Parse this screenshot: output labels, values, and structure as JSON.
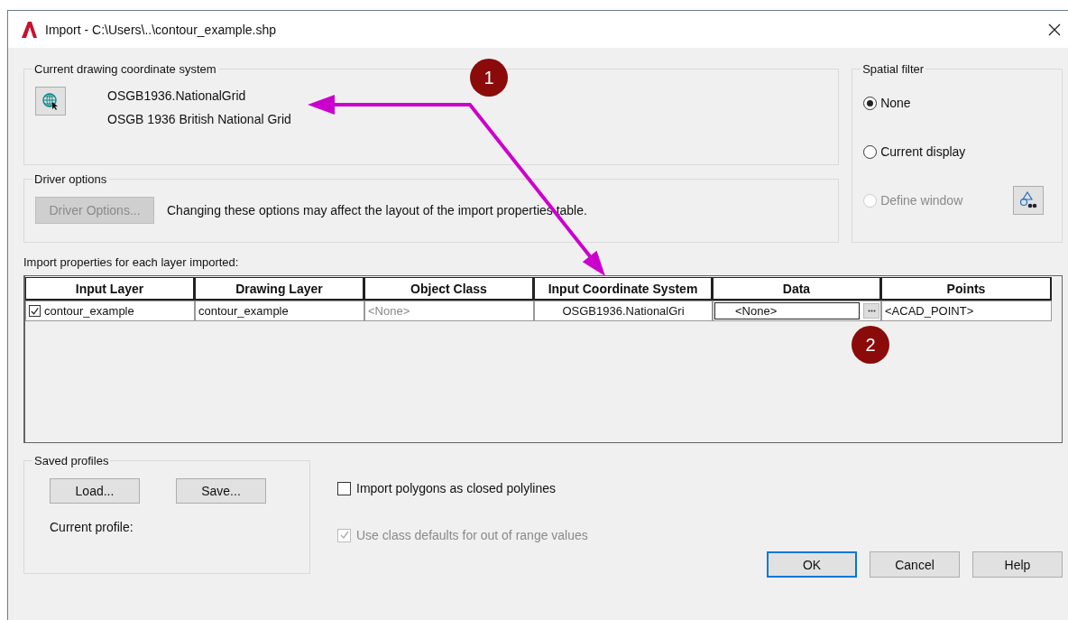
{
  "window": {
    "title": "Import - C:\\Users\\..\\contour_example.shp"
  },
  "coordinate_system": {
    "title": "Current drawing coordinate system",
    "code": "OSGB1936.NationalGrid",
    "description": "OSGB 1936 British National Grid"
  },
  "driver_options": {
    "title": "Driver options",
    "button": {
      "label": "Driver Options...",
      "disabled": true
    },
    "note": "Changing these options may affect the layout of the import properties table."
  },
  "spatial_filter": {
    "title": "Spatial filter",
    "options": [
      {
        "label": "None",
        "selected": true,
        "disabled": false
      },
      {
        "label": "Current display",
        "selected": false,
        "disabled": false
      },
      {
        "label": "Define window",
        "selected": false,
        "disabled": true
      }
    ]
  },
  "table": {
    "caption": "Import properties for each layer imported:",
    "columns": [
      "Input Layer",
      "Drawing Layer",
      "Object Class",
      "Input Coordinate System",
      "Data",
      "Points"
    ],
    "rows": [
      {
        "checked": true,
        "cells": [
          {
            "kind": "text",
            "text": "contour_example"
          },
          {
            "kind": "text",
            "text": "contour_example"
          },
          {
            "kind": "muted",
            "text": "<None>"
          },
          {
            "kind": "center",
            "text": "OSGB1936.NationalGri"
          },
          {
            "kind": "field",
            "text": "<None>"
          },
          {
            "kind": "text",
            "text": "<ACAD_POINT>"
          }
        ]
      }
    ]
  },
  "saved_profiles": {
    "title": "Saved profiles",
    "buttons": [
      "Load...",
      "Save..."
    ],
    "current_profile_label": "Current profile:"
  },
  "options": [
    {
      "label": "Import polygons as closed polylines",
      "checked": false,
      "disabled": false
    },
    {
      "label": "Use class defaults for out of range values",
      "checked": true,
      "disabled": true
    }
  ],
  "buttons": [
    {
      "label": "OK",
      "default": true
    },
    {
      "label": "Cancel",
      "default": false
    },
    {
      "label": "Help",
      "default": false
    }
  ],
  "annotations": [
    {
      "label": "1"
    },
    {
      "label": "2"
    }
  ]
}
